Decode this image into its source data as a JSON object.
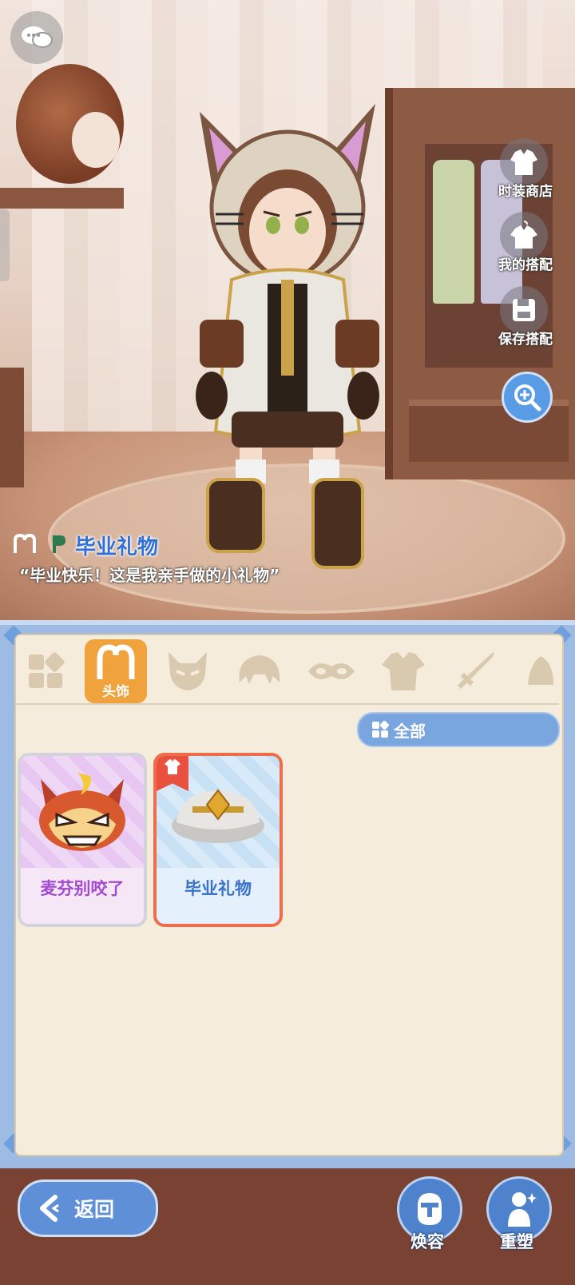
{
  "scene": {
    "item_name": "毕业礼物",
    "item_quote": "“毕业快乐！这是我亲手做的小礼物”"
  },
  "side_menu": {
    "fashion_store": "时装商店",
    "my_outfits": "我的搭配",
    "save_outfit": "保存搭配"
  },
  "tabs": {
    "active_label": "头饰",
    "icons": [
      "grid-icon",
      "headwear-icon",
      "mask-icon",
      "hair-icon",
      "eye-mask-icon",
      "clothing-icon",
      "weapon-icon",
      "cape-icon"
    ]
  },
  "filter": {
    "label": "全部"
  },
  "items": [
    {
      "name": "麦芬别咬了"
    },
    {
      "name": "毕业礼物"
    }
  ],
  "bottom": {
    "back_label": "返回",
    "makeover_label": "焕容",
    "reshape_label": "重塑"
  },
  "colors": {
    "accent_blue": "#5f8fd6",
    "active_tab": "#f0a23c",
    "selected_border": "#ee6c4b",
    "item_name": "#2f6fd6"
  }
}
